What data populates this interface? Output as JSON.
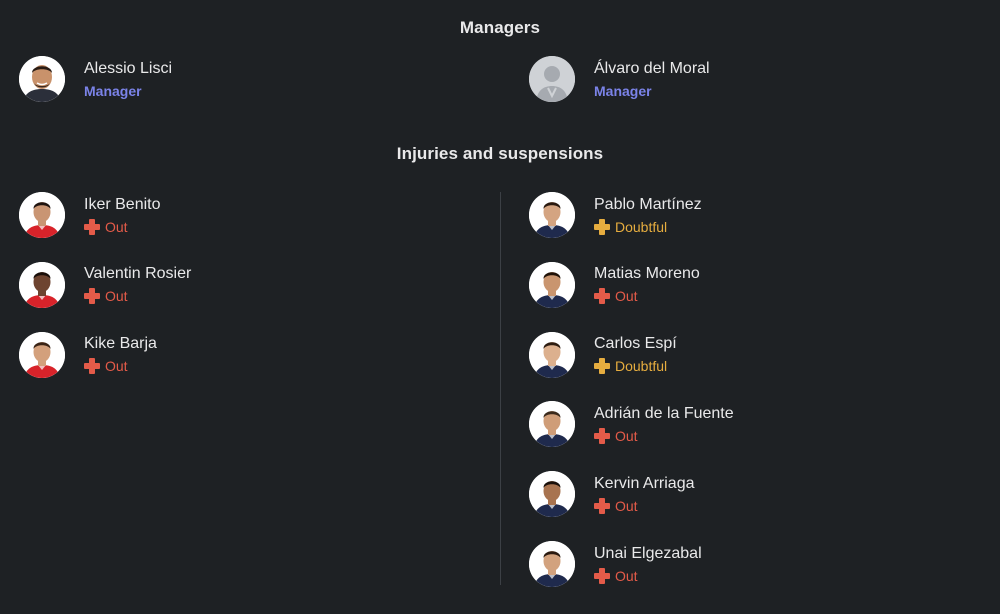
{
  "managers": {
    "title": "Managers",
    "items": [
      {
        "name": "Alessio Lisci",
        "role": "Manager"
      },
      {
        "name": "Álvaro del Moral",
        "role": "Manager"
      }
    ]
  },
  "injuries": {
    "title": "Injuries and suspensions",
    "home": [
      {
        "name": "Iker Benito",
        "status": "Out"
      },
      {
        "name": "Valentin Rosier",
        "status": "Out"
      },
      {
        "name": "Kike Barja",
        "status": "Out"
      }
    ],
    "away": [
      {
        "name": "Pablo Martínez",
        "status": "Doubtful"
      },
      {
        "name": "Matias Moreno",
        "status": "Out"
      },
      {
        "name": "Carlos Espí",
        "status": "Doubtful"
      },
      {
        "name": "Adrián de la Fuente",
        "status": "Out"
      },
      {
        "name": "Kervin Arriaga",
        "status": "Out"
      },
      {
        "name": "Unai Elgezabal",
        "status": "Out"
      }
    ]
  },
  "colors": {
    "background": "#1e2124",
    "manager_role": "#7b83e8",
    "out": "#e45b49",
    "doubtful": "#e6ad3f",
    "home_kit": "#d8232a",
    "away_kit": "#1f2a4d"
  },
  "icons": {
    "status": "plus-cross-icon",
    "avatar": "player-photo",
    "placeholder": "silhouette-icon"
  }
}
